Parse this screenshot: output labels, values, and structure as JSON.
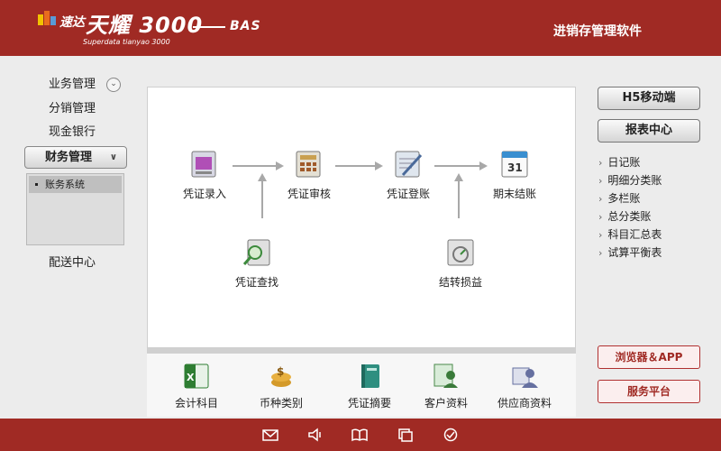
{
  "header": {
    "logo_cn": "速达",
    "logo_main": "天耀 3000",
    "logo_edition": "BAS",
    "logo_sub": "Superdata tianyao 3000",
    "app_title": "进销存管理软件",
    "brand_color": "#a02a24"
  },
  "nav": {
    "items": [
      {
        "label": "业务管理",
        "expand_icon": "chevron-down-circle-icon"
      },
      {
        "label": "分销管理"
      },
      {
        "label": "现金银行"
      },
      {
        "label": "财务管理",
        "active": true,
        "expand_icon": "double-chevron-down-icon"
      },
      {
        "label": "配送中心"
      }
    ],
    "sub_items": [
      {
        "label": "账务系统",
        "selected": true
      }
    ]
  },
  "flow": {
    "nodes": [
      {
        "label": "凭证录入",
        "icon": "voucher-entry-icon"
      },
      {
        "label": "凭证审核",
        "icon": "voucher-review-icon"
      },
      {
        "label": "凭证登账",
        "icon": "voucher-post-icon"
      },
      {
        "label": "期末结账",
        "icon": "period-close-icon"
      },
      {
        "label": "凭证查找",
        "icon": "voucher-search-icon"
      },
      {
        "label": "结转损益",
        "icon": "transfer-profit-loss-icon"
      }
    ]
  },
  "bottom_bar": {
    "items": [
      {
        "label": "会计科目",
        "icon": "excel-icon"
      },
      {
        "label": "币种类别",
        "icon": "currency-icon"
      },
      {
        "label": "凭证摘要",
        "icon": "book-icon"
      },
      {
        "label": "客户资料",
        "icon": "customer-icon"
      },
      {
        "label": "供应商资料",
        "icon": "supplier-icon"
      }
    ]
  },
  "right": {
    "buttons": [
      {
        "label": "H5移动端"
      },
      {
        "label": "报表中心"
      }
    ],
    "links": [
      "日记账",
      "明细分类账",
      "多栏账",
      "总分类账",
      "科目汇总表",
      "试算平衡表"
    ],
    "red_buttons": [
      {
        "label": "浏览器＆APP"
      },
      {
        "label": "服务平台"
      }
    ]
  },
  "footer": {
    "icons": [
      "mail-icon",
      "speaker-icon",
      "book-open-icon",
      "window-stack-icon",
      "check-circle-icon"
    ]
  }
}
